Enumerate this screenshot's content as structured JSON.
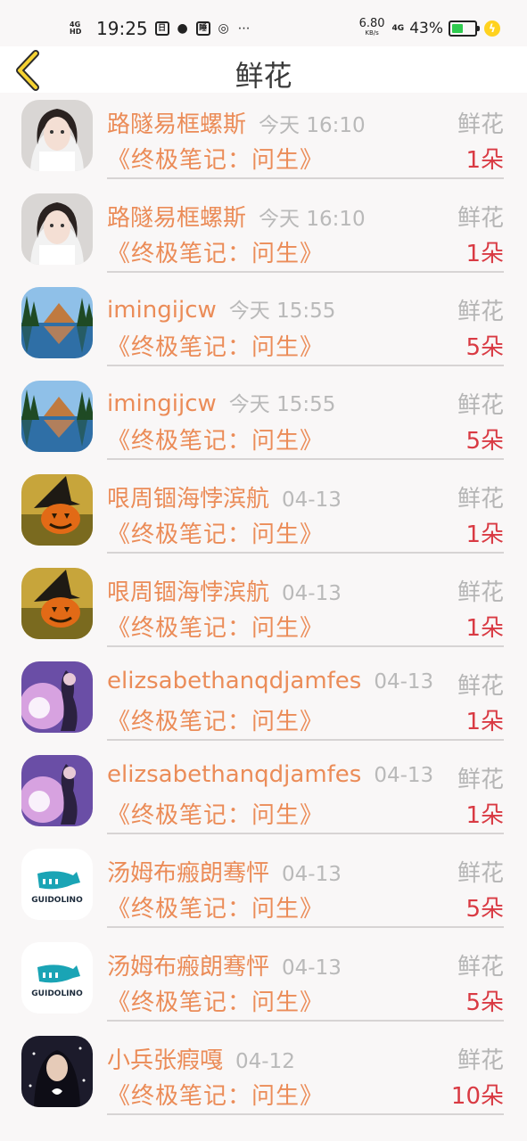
{
  "status_bar": {
    "network": "4G HD",
    "time": "19:25",
    "speed": "6.80",
    "speed_unit": "KB/s",
    "signal": "4G",
    "battery": "43%",
    "battery_color": "#2fcb4f"
  },
  "header": {
    "title": "鲜花",
    "back_icon": "chevron-left-icon"
  },
  "colors": {
    "name": "#eb8c58",
    "count": "#d93a43",
    "meta": "#b9b9b9",
    "accent_back": "#f5d232"
  },
  "items": [
    {
      "name": "路隧易框螺斯",
      "time": "今天 16:10",
      "label": "鲜花",
      "book": "《终极笔记：问生》",
      "count": "1朵",
      "avatar": "photo-girl"
    },
    {
      "name": "路隧易框螺斯",
      "time": "今天 16:10",
      "label": "鲜花",
      "book": "《终极笔记：问生》",
      "count": "1朵",
      "avatar": "photo-girl"
    },
    {
      "name": "imingijcw",
      "time": "今天 15:55",
      "label": "鲜花",
      "book": "《终极笔记：问生》",
      "count": "5朵",
      "avatar": "landscape"
    },
    {
      "name": "imingijcw",
      "time": "今天 15:55",
      "label": "鲜花",
      "book": "《终极笔记：问生》",
      "count": "5朵",
      "avatar": "landscape"
    },
    {
      "name": "哏周锢海悖滨航",
      "time": "04-13",
      "label": "鲜花",
      "book": "《终极笔记：问生》",
      "count": "1朵",
      "avatar": "pumpkin"
    },
    {
      "name": "哏周锢海悖滨航",
      "time": "04-13",
      "label": "鲜花",
      "book": "《终极笔记：问生》",
      "count": "1朵",
      "avatar": "pumpkin"
    },
    {
      "name": "elizsabethanqdjamfes",
      "time": "04-13",
      "label": "鲜花",
      "book": "《终极笔记：问生》",
      "count": "1朵",
      "avatar": "anime"
    },
    {
      "name": "elizsabethanqdjamfes",
      "time": "04-13",
      "label": "鲜花",
      "book": "《终极笔记：问生》",
      "count": "1朵",
      "avatar": "anime"
    },
    {
      "name": "汤姆布瘢朗骞怦",
      "time": "04-13",
      "label": "鲜花",
      "book": "《终极笔记：问生》",
      "count": "5朵",
      "avatar": "logo",
      "avatar_text": "GUIDOLINO"
    },
    {
      "name": "汤姆布瘢朗骞怦",
      "time": "04-13",
      "label": "鲜花",
      "book": "《终极笔记：问生》",
      "count": "5朵",
      "avatar": "logo",
      "avatar_text": "GUIDOLINO"
    },
    {
      "name": "小兵张瘕嘎",
      "time": "04-12",
      "label": "鲜花",
      "book": "《终极笔记：问生》",
      "count": "10朵",
      "avatar": "dark-girl"
    }
  ]
}
